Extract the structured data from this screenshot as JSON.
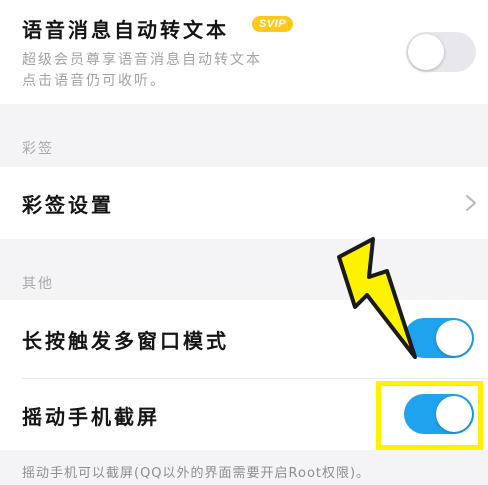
{
  "voice_to_text": {
    "title": "语音消息自动转文本",
    "badge": "SVIP",
    "description_line1": "超级会员尊享语音消息自动转文本",
    "description_line2": "点击语音仍可收听。",
    "enabled": false
  },
  "section_colorful": {
    "label": "彩签",
    "item_label": "彩签设置"
  },
  "section_other": {
    "label": "其他",
    "multi_window": {
      "title": "长按触发多窗口模式",
      "enabled": true
    },
    "shake_screenshot": {
      "title": "摇动手机截屏",
      "enabled": true
    }
  },
  "footer_note": "摇动手机可以截屏(QQ以外的界面需要开启Root权限)。",
  "colors": {
    "toggle_on": "#1fa3ef",
    "toggle_off": "#e8e8ec",
    "badge": "#ffc81a",
    "highlight": "#fff200",
    "bolt": "#fff200"
  },
  "icons": {
    "chevron": "chevron-right-icon",
    "annotation": "lightning-bolt-icon"
  }
}
